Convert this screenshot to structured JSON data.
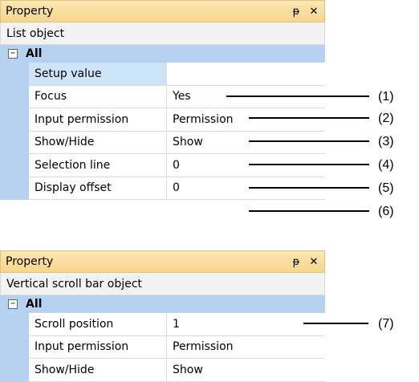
{
  "panel1": {
    "title": "Property",
    "pin_glyph": "ᵽ",
    "close_glyph": "✕",
    "object_name": "List object",
    "category": {
      "expander": "−",
      "label": "All"
    },
    "rows": [
      {
        "name": "Setup value",
        "value": "",
        "selected": true
      },
      {
        "name": "Focus",
        "value": "Yes"
      },
      {
        "name": "Input permission",
        "value": "Permission"
      },
      {
        "name": "Show/Hide",
        "value": "Show"
      },
      {
        "name": "Selection line",
        "value": "0"
      },
      {
        "name": "Display offset",
        "value": "0"
      }
    ]
  },
  "panel2": {
    "title": "Property",
    "pin_glyph": "ᵽ",
    "close_glyph": "✕",
    "object_name": "Vertical scroll bar object",
    "category": {
      "expander": "−",
      "label": "All"
    },
    "rows": [
      {
        "name": "Scroll position",
        "value": "1"
      },
      {
        "name": "Input permission",
        "value": "Permission"
      },
      {
        "name": "Show/Hide",
        "value": "Show"
      }
    ]
  },
  "callouts": [
    "(1)",
    "(2)",
    "(3)",
    "(4)",
    "(5)",
    "(6)",
    "(7)"
  ]
}
